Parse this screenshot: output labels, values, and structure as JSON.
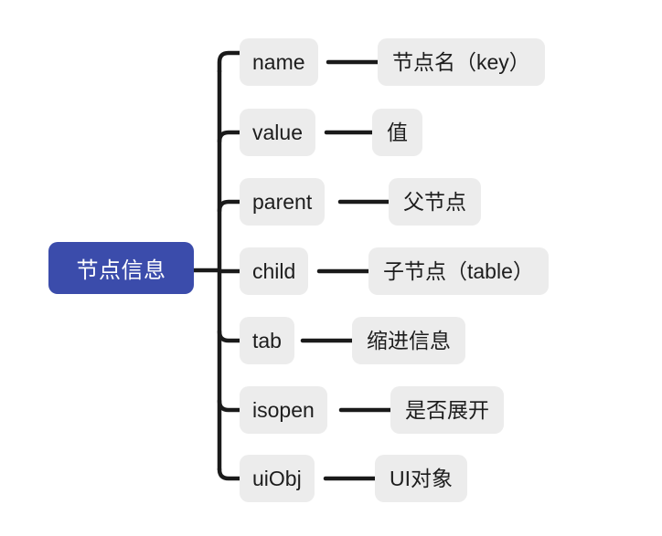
{
  "diagram": {
    "type": "mind-map",
    "title": "节点信息",
    "orientation": "left-to-right",
    "colors": {
      "root_fill": "#3B4CAB",
      "root_text": "#FFFFFF",
      "node_fill": "#ECECEC",
      "node_text": "#1D1D1D",
      "connector": "#1A1A1A",
      "background": "#FFFFFF"
    },
    "root": {
      "label": "节点信息"
    },
    "branches": [
      {
        "key": "name",
        "value": "节点名（key）"
      },
      {
        "key": "value",
        "value": "值"
      },
      {
        "key": "parent",
        "value": "父节点"
      },
      {
        "key": "child",
        "value": "子节点（table）"
      },
      {
        "key": "tab",
        "value": "缩进信息"
      },
      {
        "key": "isopen",
        "value": "是否展开"
      },
      {
        "key": "uiObj",
        "value": "UI对象"
      }
    ]
  }
}
